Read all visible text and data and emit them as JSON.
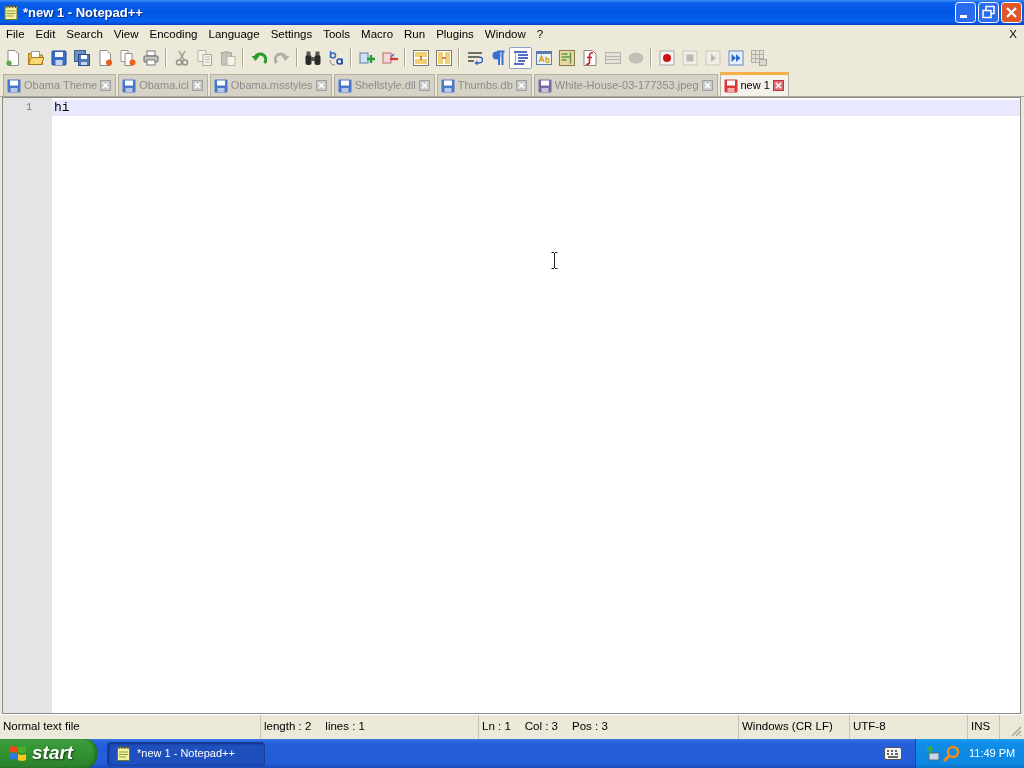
{
  "window": {
    "title": "*new 1 - Notepad++"
  },
  "menu": {
    "items": [
      "File",
      "Edit",
      "Search",
      "View",
      "Encoding",
      "Language",
      "Settings",
      "Tools",
      "Macro",
      "Run",
      "Plugins",
      "Window",
      "?"
    ],
    "close_label": "X"
  },
  "toolbar": {
    "groups": [
      [
        {
          "disabled": false,
          "on": false
        },
        {
          "disabled": false,
          "on": false
        },
        {
          "disabled": false,
          "on": false
        },
        {
          "disabled": false,
          "on": false
        },
        {
          "disabled": false,
          "on": false
        },
        {
          "disabled": false,
          "on": false
        },
        {
          "disabled": false,
          "on": false
        }
      ],
      [
        {
          "disabled": true,
          "on": false
        },
        {
          "disabled": true,
          "on": false
        },
        {
          "disabled": true,
          "on": false
        }
      ],
      [
        {
          "disabled": false,
          "on": false
        },
        {
          "disabled": true,
          "on": false
        }
      ],
      [
        {
          "disabled": false,
          "on": false
        },
        {
          "disabled": false,
          "on": false
        }
      ],
      [
        {
          "disabled": false,
          "on": false
        },
        {
          "disabled": false,
          "on": false
        }
      ],
      [
        {
          "disabled": false,
          "on": false
        },
        {
          "disabled": false,
          "on": false
        }
      ],
      [
        {
          "disabled": false,
          "on": false
        },
        {
          "disabled": false,
          "on": false
        },
        {
          "disabled": false,
          "on": true
        },
        {
          "disabled": false,
          "on": false
        },
        {
          "disabled": false,
          "on": false
        },
        {
          "disabled": false,
          "on": false
        },
        {
          "disabled": true,
          "on": false
        },
        {
          "disabled": true,
          "on": false
        }
      ],
      [
        {
          "disabled": false,
          "on": false
        },
        {
          "disabled": true,
          "on": false
        },
        {
          "disabled": true,
          "on": false
        },
        {
          "disabled": false,
          "on": false
        },
        {
          "disabled": true,
          "on": false
        }
      ]
    ]
  },
  "tabs": [
    {
      "label": "Obama Theme",
      "selected": false,
      "color": "#4a78c8"
    },
    {
      "label": "Obama.icl",
      "selected": false,
      "color": "#4a78c8"
    },
    {
      "label": "Obama.msstyles",
      "selected": false,
      "color": "#4a78c8"
    },
    {
      "label": "Shellstyle.dll",
      "selected": false,
      "color": "#4a78c8"
    },
    {
      "label": "Thumbs.db",
      "selected": false,
      "color": "#4a78c8"
    },
    {
      "label": "White-House-03-177353.jpeg",
      "selected": false,
      "color": "#7a68a8"
    },
    {
      "label": "new 1",
      "selected": true,
      "color": "#d83838"
    }
  ],
  "editor": {
    "lines": [
      {
        "number": "1",
        "text": "hi",
        "current": true
      }
    ]
  },
  "status_bar": {
    "panels": [
      [
        "Normal text file"
      ],
      [
        "length : 2",
        "lines : 1"
      ],
      [
        "Ln : 1",
        "Col : 3",
        "Pos : 3"
      ],
      [
        "Windows (CR LF)"
      ],
      [
        "UTF-8"
      ],
      [
        "INS"
      ]
    ]
  },
  "taskbar": {
    "start_label": "start",
    "tasks": [
      {
        "label": "*new 1 - Notepad++",
        "selected": true
      }
    ],
    "clock": "11:49 PM"
  }
}
